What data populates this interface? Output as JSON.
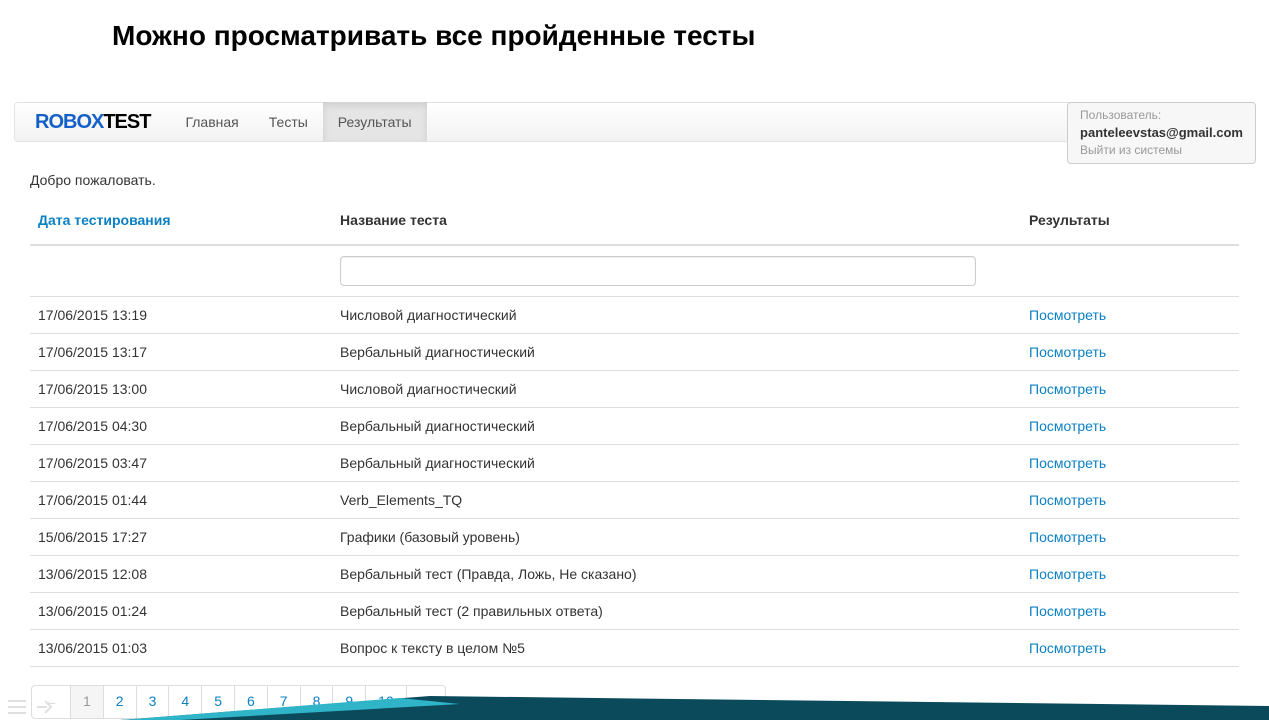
{
  "page_heading": "Можно просматривать все пройденные тесты",
  "logo": {
    "part1": "ROBOX",
    "part2": "TEST"
  },
  "nav": {
    "items": [
      {
        "label": "Главная",
        "active": false
      },
      {
        "label": "Тесты",
        "active": false
      },
      {
        "label": "Результаты",
        "active": true
      }
    ]
  },
  "user": {
    "label": "Пользователь:",
    "email": "panteleevstas@gmail.com",
    "logout": "Выйти из системы"
  },
  "welcome": "Добро пожаловать.",
  "table": {
    "headers": {
      "date": "Дата тестирования",
      "name": "Название теста",
      "results": "Результаты"
    },
    "filter_value": "",
    "action_label": "Посмотреть",
    "rows": [
      {
        "date": "17/06/2015 13:19",
        "name": "Числовой диагностический"
      },
      {
        "date": "17/06/2015 13:17",
        "name": "Вербальный диагностический"
      },
      {
        "date": "17/06/2015 13:00",
        "name": "Числовой диагностический"
      },
      {
        "date": "17/06/2015 04:30",
        "name": "Вербальный диагностический"
      },
      {
        "date": "17/06/2015 03:47",
        "name": "Вербальный диагностический"
      },
      {
        "date": "17/06/2015 01:44",
        "name": "Verb_Elements_TQ"
      },
      {
        "date": "15/06/2015 17:27",
        "name": "Графики (базовый уровень)"
      },
      {
        "date": "13/06/2015 12:08",
        "name": "Вербальный тест (Правда, Ложь, Не сказано)"
      },
      {
        "date": "13/06/2015 01:24",
        "name": "Вербальный тест (2 правильных ответа)"
      },
      {
        "date": "13/06/2015 01:03",
        "name": "Вопрос к тексту в целом №5"
      }
    ]
  },
  "pagination": {
    "prev": "←",
    "next": "→",
    "pages": [
      "1",
      "2",
      "3",
      "4",
      "5",
      "6",
      "7",
      "8",
      "9",
      "10"
    ],
    "active": "1"
  }
}
